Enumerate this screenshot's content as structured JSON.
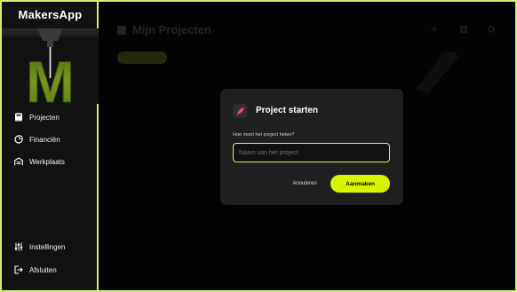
{
  "app": {
    "brand": "MakersApp",
    "logo_letter": "M"
  },
  "sidebar": {
    "items": [
      {
        "label": "Projecten",
        "icon": "book-icon"
      },
      {
        "label": "Financiën",
        "icon": "pie-chart-icon"
      },
      {
        "label": "Werkplaats",
        "icon": "warehouse-icon"
      }
    ],
    "bottom_items": [
      {
        "label": "Instellingen",
        "icon": "sliders-icon"
      },
      {
        "label": "Afsluiten",
        "icon": "logout-icon"
      }
    ]
  },
  "main": {
    "page_title": "Mijn Projecten"
  },
  "dialog": {
    "title": "Project starten",
    "question": "Hoe moet het project heten?",
    "input_placeholder": "Naam van het project",
    "input_value": "",
    "cancel_label": "Annuleren",
    "create_label": "Aanmaken",
    "icon": "feather-icon"
  },
  "colors": {
    "accent": "#d6f500",
    "frame": "#d6f26b",
    "sidebar_bg": "#121212",
    "dialog_bg": "#1f1f1f",
    "logo_green": "#6d8f1f"
  }
}
